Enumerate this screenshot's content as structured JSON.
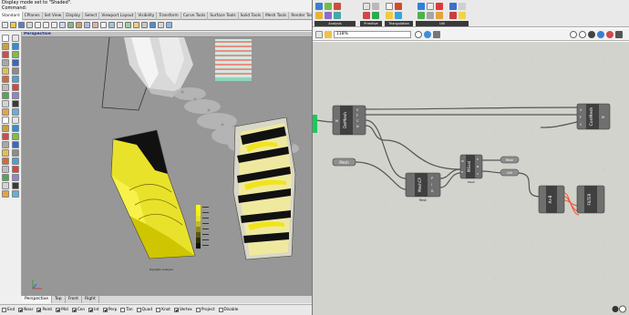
{
  "rhino": {
    "command_history": "Display mode set to \"Shaded\".",
    "command_prompt": "Command:",
    "tabs": [
      {
        "label": "Standard",
        "active": true
      },
      {
        "label": "CPlanes"
      },
      {
        "label": "Set View"
      },
      {
        "label": "Display"
      },
      {
        "label": "Select"
      },
      {
        "label": "Viewport Layout"
      },
      {
        "label": "Visibility"
      },
      {
        "label": "Transform"
      },
      {
        "label": "Curve Tools"
      },
      {
        "label": "Surface Tools"
      },
      {
        "label": "Solid Tools"
      },
      {
        "label": "Mesh Tools"
      },
      {
        "label": "Render Tools"
      },
      {
        "label": "Draf"
      }
    ],
    "viewport": {
      "title": "Perspective",
      "legend_caption": "Daylight Analysis"
    },
    "view_tabs": [
      {
        "label": "Perspective",
        "active": true
      },
      {
        "label": "Top"
      },
      {
        "label": "Front"
      },
      {
        "label": "Right"
      }
    ],
    "osnaps": [
      {
        "label": "End",
        "checked": false
      },
      {
        "label": "Near",
        "checked": true
      },
      {
        "label": "Point",
        "checked": true
      },
      {
        "label": "Mid",
        "checked": true
      },
      {
        "label": "Cen",
        "checked": true
      },
      {
        "label": "Int",
        "checked": true
      },
      {
        "label": "Perp",
        "checked": true
      },
      {
        "label": "Tan",
        "checked": false
      },
      {
        "label": "Quad",
        "checked": false
      },
      {
        "label": "Knot",
        "checked": false
      },
      {
        "label": "Vertex",
        "checked": true
      },
      {
        "label": "Project",
        "checked": false
      },
      {
        "label": "Disable",
        "checked": false
      }
    ]
  },
  "grasshopper": {
    "toolbar_groups": [
      "Analysis",
      "Primitive",
      "Triangulation",
      "Util"
    ],
    "zoom": "118%",
    "nodes": {
      "deconstruct_mesh": {
        "label": "DeMesh",
        "inputs": [
          "M"
        ],
        "outputs": [
          "V",
          "F",
          "C",
          "N"
        ]
      },
      "mesh_param": {
        "label": "Mesh"
      },
      "mesh_closest": {
        "label": "MeshCP",
        "outputs": [
          "P",
          "I",
          "D"
        ],
        "caption": "Mesh"
      },
      "mesh_eval": {
        "label": "MEval",
        "inputs": [
          "M",
          "P"
        ],
        "outputs": [
          "P",
          "N",
          "C"
        ],
        "caption": "Mesh"
      },
      "construct_mesh": {
        "label": "ConMesh",
        "inputs": [
          "V",
          "F",
          "C"
        ],
        "outputs": [
          "M"
        ]
      },
      "relay_a": {
        "label": "Mesh"
      },
      "relay_b": {
        "label": "Cell"
      },
      "compare_a": {
        "label": "A>B"
      },
      "compare_b": {
        "label": "FILTER"
      }
    }
  },
  "colors": {
    "yellow_mesh": "#e9e22a",
    "wire": "#555555",
    "selected_wire": "#f25533",
    "node": "#6f6f6f",
    "canvas": "#d3d3cd",
    "param_green": "#19c95a"
  }
}
